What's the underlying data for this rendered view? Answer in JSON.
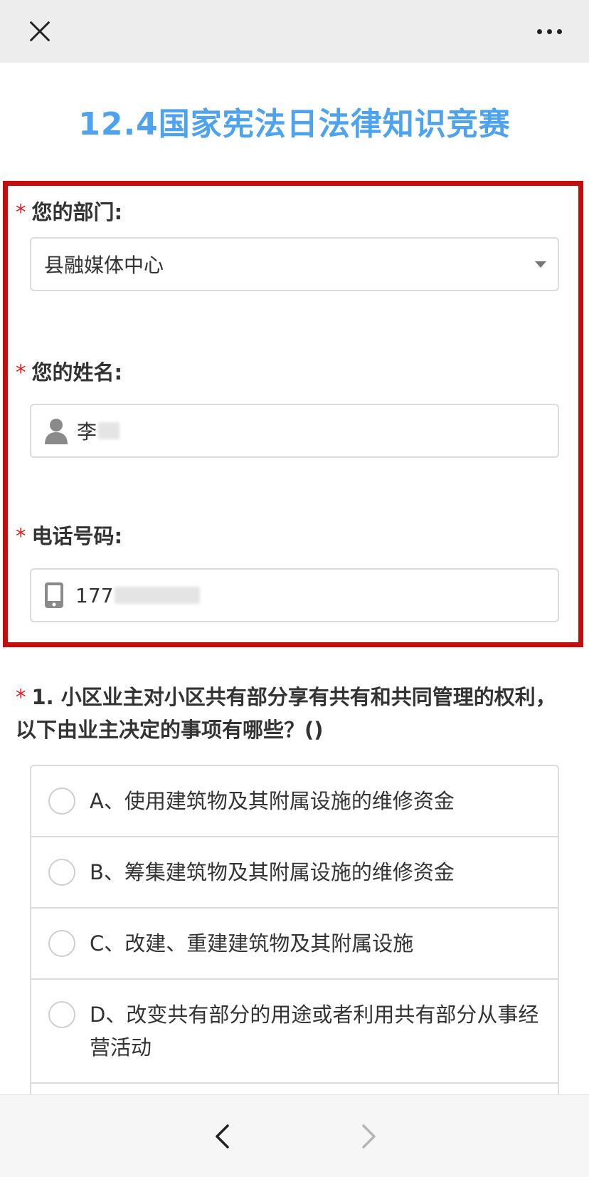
{
  "topbar": {
    "close_icon": "close-icon",
    "more_icon": "more-dots-icon"
  },
  "page": {
    "title": "12.4国家宪法日法律知识竞赛"
  },
  "form": {
    "department": {
      "required_mark": "*",
      "label": "您的部门:",
      "value": "县融媒体中心"
    },
    "name": {
      "required_mark": "*",
      "label": "您的姓名:",
      "value": "李",
      "icon": "person-icon"
    },
    "phone": {
      "required_mark": "*",
      "label": "电话号码:",
      "value": "177",
      "icon": "phone-icon"
    }
  },
  "question1": {
    "required_mark": "*",
    "text": "1. 小区业主对小区共有部分享有共有和共同管理的权利，以下由业主决定的事项有哪些？()",
    "options": [
      "A、使用建筑物及其附属设施的维修资金",
      "B、筹集建筑物及其附属设施的维修资金",
      "C、改建、重建建筑物及其附属设施",
      "D、改变共有部分的用途或者利用共有部分从事经营活动"
    ]
  },
  "bottombar": {
    "back_icon": "chevron-left-icon",
    "forward_icon": "chevron-right-icon"
  },
  "colors": {
    "title": "#4da3f0",
    "highlight": "#c40d0d",
    "required": "#e02020"
  }
}
